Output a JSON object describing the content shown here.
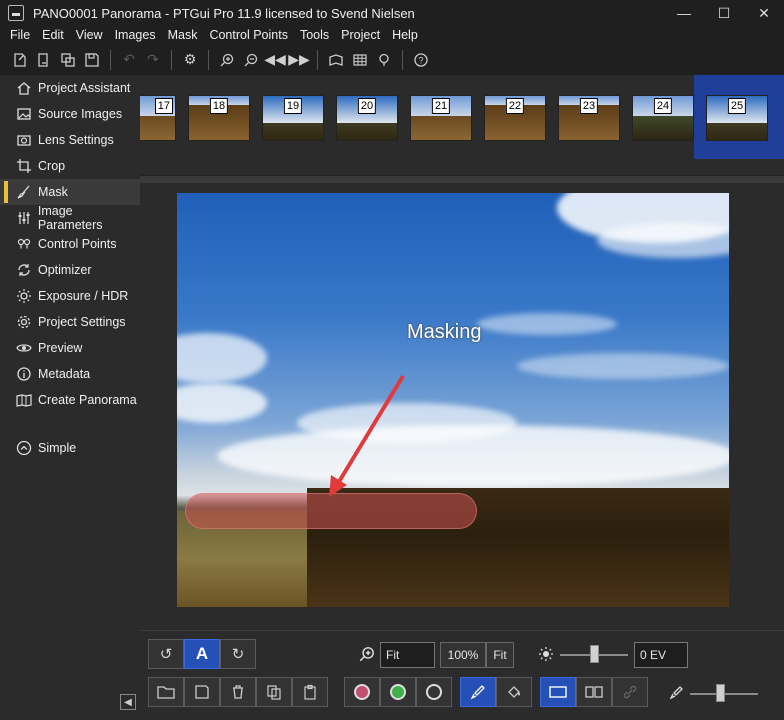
{
  "window": {
    "title": "PANO0001 Panorama - PTGui Pro 11.9 licensed to Svend Nielsen",
    "controls": [
      "minimize",
      "maximize",
      "close"
    ]
  },
  "menu": [
    "File",
    "Edit",
    "View",
    "Images",
    "Mask",
    "Control Points",
    "Tools",
    "Project",
    "Help"
  ],
  "toolbar": {
    "icons": [
      "new-project-icon",
      "open-project-icon",
      "open-images-icon",
      "save-icon",
      "undo-icon",
      "redo-icon",
      "settings-icon",
      "zoom-in-icon",
      "zoom-out-icon",
      "prev-image-icon",
      "next-image-icon",
      "panorama-editor-icon",
      "table-icon",
      "tip-icon",
      "help-icon"
    ]
  },
  "sidebar": {
    "items": [
      {
        "label": "Project Assistant",
        "icon": "home-icon"
      },
      {
        "label": "Source Images",
        "icon": "image-icon"
      },
      {
        "label": "Lens Settings",
        "icon": "camera-icon"
      },
      {
        "label": "Crop",
        "icon": "crop-icon"
      },
      {
        "label": "Mask",
        "icon": "brush-icon",
        "active": true
      },
      {
        "label": "Image Parameters",
        "icon": "sliders-icon"
      },
      {
        "label": "Control Points",
        "icon": "pins-icon"
      },
      {
        "label": "Optimizer",
        "icon": "optimize-icon"
      },
      {
        "label": "Exposure / HDR",
        "icon": "sun-icon"
      },
      {
        "label": "Project Settings",
        "icon": "gear-icon"
      },
      {
        "label": "Preview",
        "icon": "eye-icon"
      },
      {
        "label": "Metadata",
        "icon": "info-icon"
      },
      {
        "label": "Create Panorama",
        "icon": "panorama-icon"
      }
    ],
    "mode": {
      "label": "Simple",
      "icon": "chevron-up-icon"
    }
  },
  "thumbnails": [
    "17",
    "18",
    "19",
    "20",
    "21",
    "22",
    "23",
    "24",
    "25"
  ],
  "selected_thumbnail": "25",
  "canvas": {
    "annotation": "Masking"
  },
  "bottom": {
    "zoom_value": "Fit",
    "zoom_100": "100%",
    "zoom_fit": "Fit",
    "ev_value": "0 EV",
    "text_button": "A"
  }
}
